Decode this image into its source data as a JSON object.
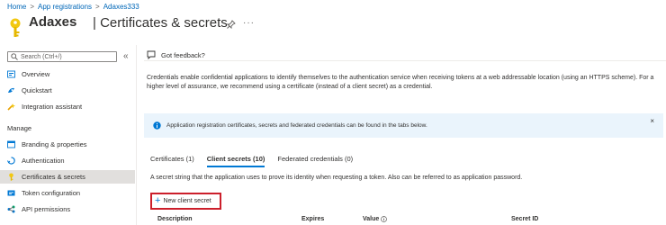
{
  "breadcrumb": [
    {
      "label": "Home"
    },
    {
      "label": "App registrations"
    },
    {
      "label": "Adaxes333"
    }
  ],
  "breadcrumb_separator": ">",
  "header": {
    "app_name": "Adaxes",
    "title": "| Certificates & secrets",
    "more": "···"
  },
  "sidebar": {
    "search_placeholder": "Search (Ctrl+/)",
    "collapse": "«",
    "items_top": [
      {
        "label": "Overview",
        "icon": "overview-icon"
      },
      {
        "label": "Quickstart",
        "icon": "quickstart-icon"
      },
      {
        "label": "Integration assistant",
        "icon": "integration-assistant-icon"
      }
    ],
    "section_manage": "Manage",
    "items_manage": [
      {
        "label": "Branding & properties",
        "icon": "branding-icon"
      },
      {
        "label": "Authentication",
        "icon": "authentication-icon"
      },
      {
        "label": "Certificates & secrets",
        "icon": "key-icon",
        "active": true
      },
      {
        "label": "Token configuration",
        "icon": "token-icon"
      },
      {
        "label": "API permissions",
        "icon": "api-permissions-icon"
      }
    ]
  },
  "feedback": {
    "label": "Got feedback?"
  },
  "description": "Credentials enable confidential applications to identify themselves to the authentication service when receiving tokens at a web addressable location (using an HTTPS scheme). For a higher level of assurance, we recommend using a certificate (instead of a client secret) as a credential.",
  "info_bar": {
    "text": "Application registration certificates, secrets and federated credentials can be found in the tabs below.",
    "close": "×"
  },
  "tabs": [
    {
      "label": "Certificates (1)"
    },
    {
      "label": "Client secrets (10)",
      "active": true
    },
    {
      "label": "Federated credentials (0)"
    }
  ],
  "tab_description": "A secret string that the application uses to prove its identity when requesting a token. Also can be referred to as application password.",
  "new_secret": {
    "plus": "+",
    "label": "New client secret"
  },
  "columns": [
    "Description",
    "Expires",
    "Value",
    "Secret ID"
  ],
  "colors": {
    "accent": "#0078d4",
    "highlight": "#cc1f2b",
    "info_bg": "#eaf4fc",
    "active_nav": "#e1dfdd"
  }
}
